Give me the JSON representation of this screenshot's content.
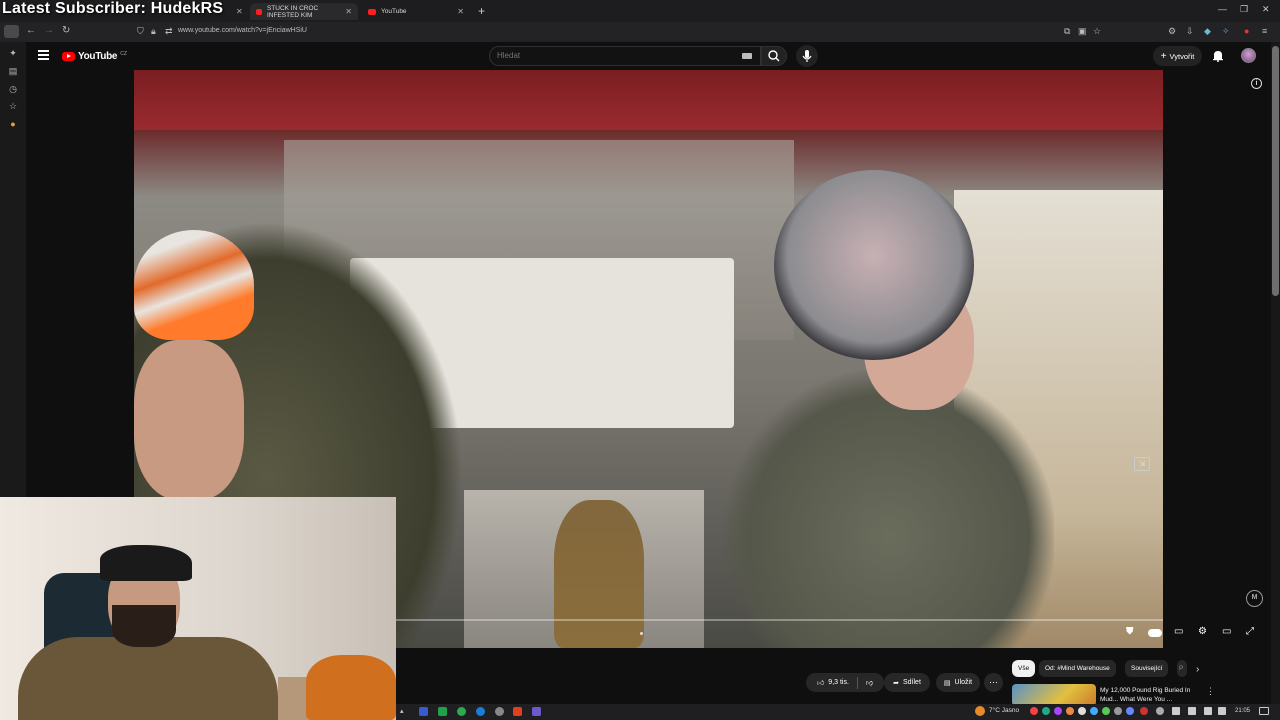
{
  "stream_overlay": {
    "text": "Latest Subscriber: HudekRS"
  },
  "browser": {
    "tabs": [
      {
        "label": "STUCK IN CROC INFESTED KIM"
      },
      {
        "label": "YouTube"
      }
    ],
    "url": "www.youtube.com/watch?v=jEnciawHSiU"
  },
  "youtube": {
    "logo_text": "YouTube",
    "logo_country": "CZ",
    "search_placeholder": "Hledat",
    "create_label": "Vytvořit",
    "likes": "9,3 tis.",
    "share_label": "Sdílet",
    "save_label": "Uložit",
    "chips": [
      "Vše",
      "Od: #Mind Warehouse",
      "Související",
      "P"
    ],
    "recommendation": {
      "title": "My 12,000 Pound Rig Buried In Mud... What Were You ..."
    }
  },
  "taskbar": {
    "weather": "7°C  Jasno",
    "time": "21:05"
  },
  "colors": {
    "yt_red": "#ff0000",
    "bg": "#0f0f0f",
    "chip_active": "#f1f1f1"
  }
}
